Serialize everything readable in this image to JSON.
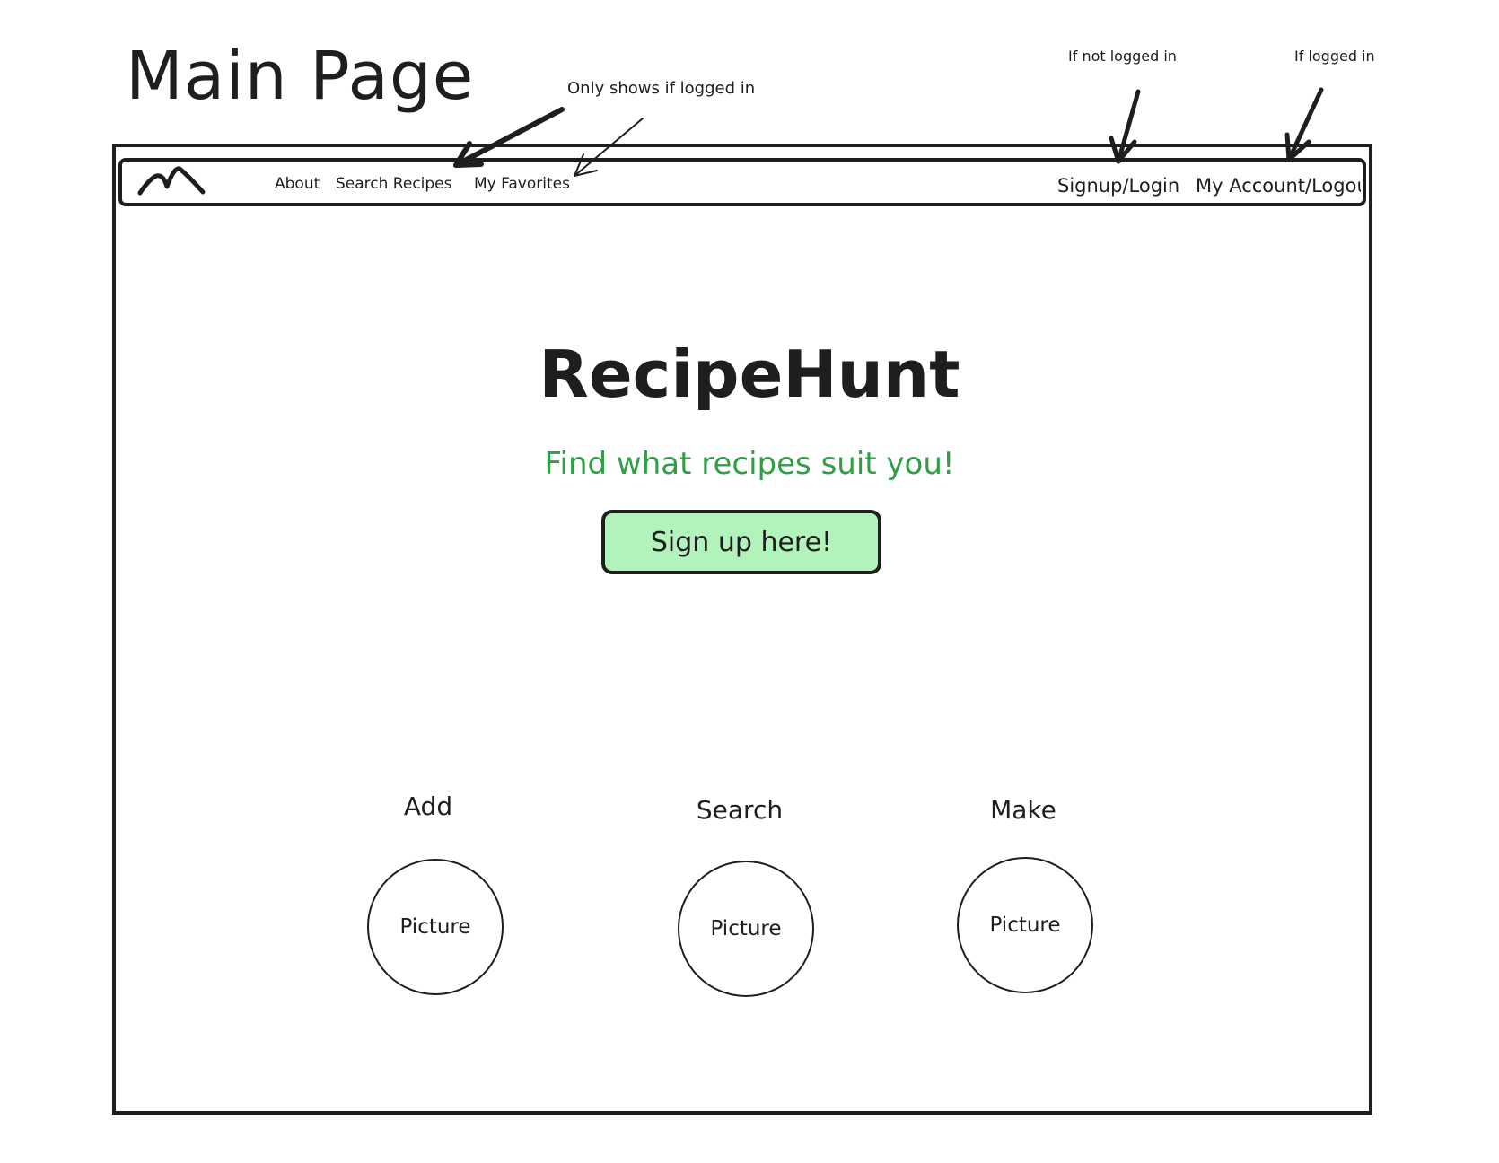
{
  "annotations": {
    "page_title": "Main Page",
    "favorites_note": "Only shows if logged in",
    "not_logged_in_note": "If not logged in",
    "logged_in_note": "If logged in"
  },
  "navbar": {
    "logo_icon": "mountain-logo-icon",
    "links": [
      "About",
      "Search Recipes",
      "My Favorites"
    ],
    "signup_login": "Signup/Login",
    "account_logout": "My Account/Logout"
  },
  "hero": {
    "title": "RecipeHunt",
    "subtitle": "Find what recipes suit you!",
    "cta_label": "Sign up here!",
    "subtitle_color": "#2f9e44",
    "cta_color": "#b2f2bb"
  },
  "features": [
    {
      "label": "Add",
      "picture": "Picture"
    },
    {
      "label": "Search",
      "picture": "Picture"
    },
    {
      "label": "Make",
      "picture": "Picture"
    }
  ]
}
